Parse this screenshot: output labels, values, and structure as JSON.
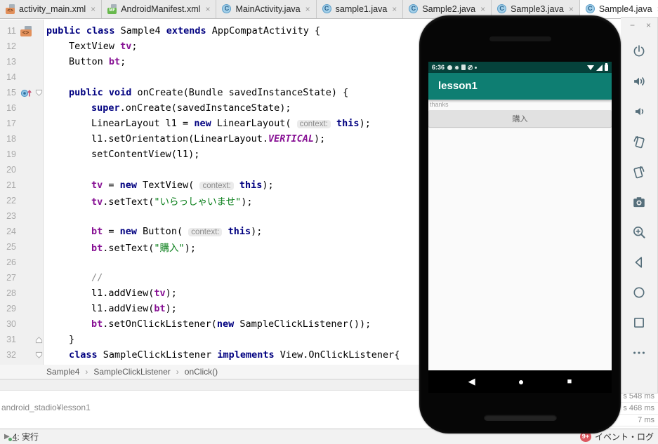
{
  "tabs": [
    {
      "label": "activity_main.xml",
      "icon": "xml",
      "active": false
    },
    {
      "label": "AndroidManifest.xml",
      "icon": "manifest",
      "active": false
    },
    {
      "label": "MainActivity.java",
      "icon": "class",
      "active": false
    },
    {
      "label": "sample1.java",
      "icon": "class",
      "active": false
    },
    {
      "label": "Sample2.java",
      "icon": "class",
      "active": false
    },
    {
      "label": "Sample3.java",
      "icon": "class",
      "active": false
    },
    {
      "label": "Sample4.java",
      "icon": "class",
      "active": true
    }
  ],
  "tab_close_glyph": "×",
  "editor": {
    "lines": [
      {
        "n": 11,
        "i": 0,
        "g": "layout-xml",
        "seg": [
          [
            "k",
            "public class "
          ],
          [
            "p",
            "Sample4 "
          ],
          [
            "k",
            "extends"
          ],
          [
            "p",
            " AppCompatActivity {"
          ]
        ]
      },
      {
        "n": 12,
        "i": 1,
        "seg": [
          [
            "p",
            "TextView "
          ],
          [
            "f",
            "tv"
          ],
          [
            "p",
            ";"
          ]
        ]
      },
      {
        "n": 13,
        "i": 1,
        "seg": [
          [
            "p",
            "Button "
          ],
          [
            "f",
            "bt"
          ],
          [
            "p",
            ";"
          ]
        ]
      },
      {
        "n": 14,
        "i": 0,
        "seg": []
      },
      {
        "n": 15,
        "i": 1,
        "g": "override",
        "fold": "down",
        "seg": [
          [
            "k",
            "public void "
          ],
          [
            "p",
            "onCreate(Bundle savedInstanceState) {"
          ]
        ]
      },
      {
        "n": 16,
        "i": 2,
        "seg": [
          [
            "k",
            "super"
          ],
          [
            "p",
            ".onCreate(savedInstanceState);"
          ]
        ]
      },
      {
        "n": 17,
        "i": 2,
        "seg": [
          [
            "p",
            "LinearLayout l1 = "
          ],
          [
            "k",
            "new"
          ],
          [
            "p",
            " LinearLayout( "
          ],
          [
            "h",
            "context:"
          ],
          [
            "p",
            " "
          ],
          [
            "k",
            "this"
          ],
          [
            "p",
            ");"
          ]
        ]
      },
      {
        "n": 18,
        "i": 2,
        "seg": [
          [
            "p",
            "l1.setOrientation(LinearLayout."
          ],
          [
            "c",
            "VERTICAL"
          ],
          [
            "p",
            ");"
          ]
        ]
      },
      {
        "n": 19,
        "i": 2,
        "seg": [
          [
            "p",
            "setContentView(l1);"
          ]
        ]
      },
      {
        "n": 20,
        "i": 0,
        "seg": []
      },
      {
        "n": 21,
        "i": 2,
        "seg": [
          [
            "f",
            "tv"
          ],
          [
            "p",
            " = "
          ],
          [
            "k",
            "new"
          ],
          [
            "p",
            " TextView( "
          ],
          [
            "h",
            "context:"
          ],
          [
            "p",
            " "
          ],
          [
            "k",
            "this"
          ],
          [
            "p",
            ");"
          ]
        ]
      },
      {
        "n": 22,
        "i": 2,
        "seg": [
          [
            "f",
            "tv"
          ],
          [
            "p",
            ".setText("
          ],
          [
            "s",
            "\"いらっしゃいませ\""
          ],
          [
            "p",
            ");"
          ]
        ]
      },
      {
        "n": 23,
        "i": 0,
        "seg": []
      },
      {
        "n": 24,
        "i": 2,
        "seg": [
          [
            "f",
            "bt"
          ],
          [
            "p",
            " = "
          ],
          [
            "k",
            "new"
          ],
          [
            "p",
            " Button( "
          ],
          [
            "h",
            "context:"
          ],
          [
            "p",
            " "
          ],
          [
            "k",
            "this"
          ],
          [
            "p",
            ");"
          ]
        ]
      },
      {
        "n": 25,
        "i": 2,
        "seg": [
          [
            "f",
            "bt"
          ],
          [
            "p",
            ".setText("
          ],
          [
            "s",
            "\"購入\""
          ],
          [
            "p",
            ");"
          ]
        ]
      },
      {
        "n": 26,
        "i": 0,
        "seg": []
      },
      {
        "n": 27,
        "i": 2,
        "seg": [
          [
            "m",
            "//"
          ]
        ]
      },
      {
        "n": 28,
        "i": 2,
        "seg": [
          [
            "p",
            "l1.addView("
          ],
          [
            "f",
            "tv"
          ],
          [
            "p",
            ");"
          ]
        ]
      },
      {
        "n": 29,
        "i": 2,
        "seg": [
          [
            "p",
            "l1.addView("
          ],
          [
            "f",
            "bt"
          ],
          [
            "p",
            ");"
          ]
        ]
      },
      {
        "n": 30,
        "i": 2,
        "seg": [
          [
            "f",
            "bt"
          ],
          [
            "p",
            ".setOnClickListener("
          ],
          [
            "k",
            "new"
          ],
          [
            "p",
            " SampleClickListener());"
          ]
        ]
      },
      {
        "n": 31,
        "i": 1,
        "fold": "up",
        "seg": [
          [
            "p",
            "}"
          ]
        ]
      },
      {
        "n": 32,
        "i": 1,
        "fold": "down",
        "seg": [
          [
            "k",
            "class"
          ],
          [
            "p",
            " SampleClickListener "
          ],
          [
            "k",
            "implements"
          ],
          [
            "p",
            " View.OnClickListener{"
          ]
        ]
      }
    ]
  },
  "breadcrumbs": [
    "Sample4",
    "SampleClickListener",
    "onClick()"
  ],
  "emulator": {
    "winbtns": {
      "minimize": "−",
      "close": "×"
    },
    "status_time": "6:36",
    "status_icons_left": [
      "gear",
      "play",
      "storage",
      "no-signal",
      "dot"
    ],
    "status_icons_right": [
      "wifi",
      "signal",
      "battery"
    ],
    "app_title": "lesson1",
    "content_text": "thanks",
    "button_label": "購入",
    "nav_icons": [
      "back",
      "home",
      "overview"
    ],
    "toolbar_icons": [
      "power",
      "volume-up",
      "volume-down",
      "rotate-left",
      "rotate-right",
      "camera",
      "zoom",
      "back",
      "home",
      "overview",
      "more"
    ]
  },
  "bottom": {
    "project_path": "android_stadio¥lesson1",
    "timings": [
      "s 548 ms",
      "s 468 ms",
      "7 ms"
    ],
    "run_tab_num": "4",
    "run_tab_rest": ": 実行",
    "run_glyph": "▶",
    "event_badge": "9+",
    "event_log": "イベント・ログ",
    "log_minimize": "−"
  },
  "colors": {
    "app_bar_teal": "#0E7E72",
    "status_bar_teal": "#05423B",
    "keyword_navy": "#000080",
    "field_purple": "#871094",
    "string_green": "#067D17",
    "badge_red": "#DB5860",
    "toolbar_icon_steel": "#566F7B"
  }
}
